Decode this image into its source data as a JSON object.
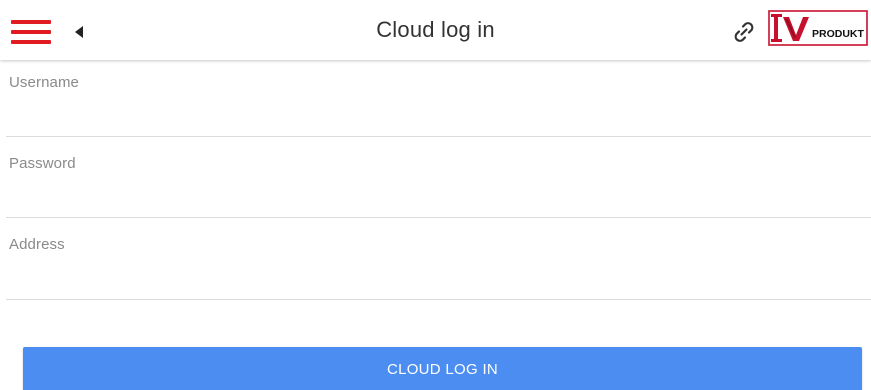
{
  "header": {
    "title": "Cloud log in",
    "menu_icon": "hamburger-menu-icon",
    "back_icon": "caret-left-icon",
    "link_icon": "link-icon",
    "logo": {
      "text_main": "IV",
      "text_sub": "PRODUKT"
    }
  },
  "form": {
    "username": {
      "label": "Username",
      "value": ""
    },
    "password": {
      "label": "Password",
      "value": ""
    },
    "address": {
      "label": "Address",
      "value": ""
    }
  },
  "actions": {
    "login_label": "CLOUD LOG IN"
  },
  "colors": {
    "menu_red": "#e01b22",
    "button_blue": "#4c8df1",
    "label_gray": "#8a8a8a",
    "divider": "#dcdcdc"
  }
}
